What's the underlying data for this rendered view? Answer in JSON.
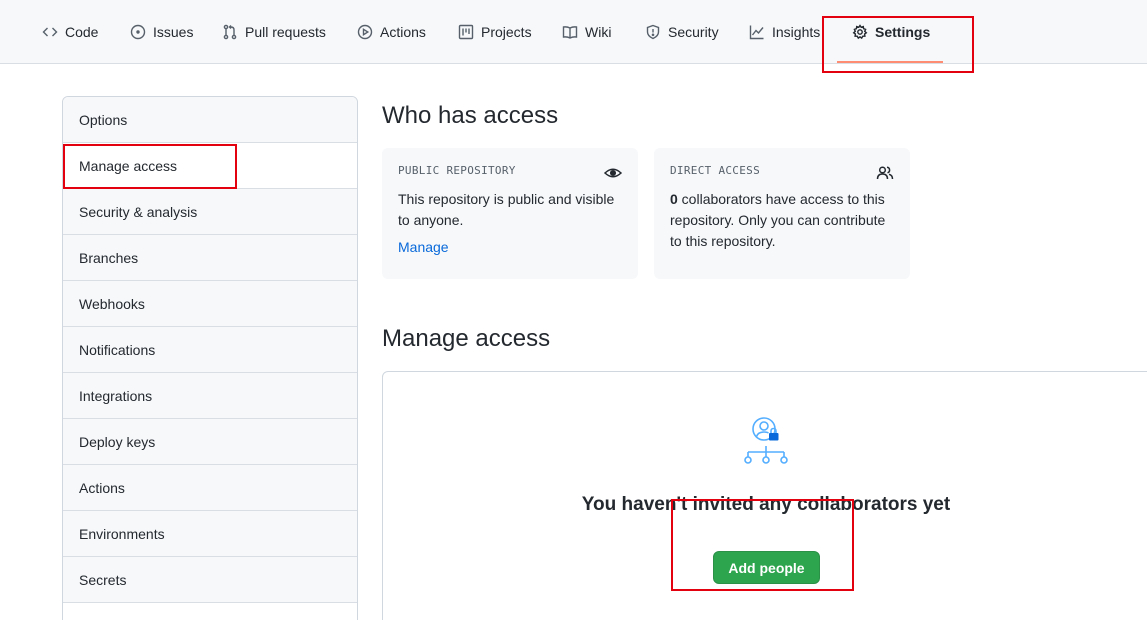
{
  "nav": {
    "tabs": [
      {
        "label": "Code",
        "icon": "code-icon"
      },
      {
        "label": "Issues",
        "icon": "issue-opened-icon"
      },
      {
        "label": "Pull requests",
        "icon": "git-pull-request-icon"
      },
      {
        "label": "Actions",
        "icon": "play-icon"
      },
      {
        "label": "Projects",
        "icon": "project-icon"
      },
      {
        "label": "Wiki",
        "icon": "book-icon"
      },
      {
        "label": "Security",
        "icon": "shield-icon"
      },
      {
        "label": "Insights",
        "icon": "graph-icon"
      },
      {
        "label": "Settings",
        "icon": "gear-icon"
      }
    ],
    "active": "Settings",
    "active_underline_color": "#fd8c73"
  },
  "sidebar": {
    "items": [
      {
        "label": "Options"
      },
      {
        "label": "Manage access"
      },
      {
        "label": "Security & analysis"
      },
      {
        "label": "Branches"
      },
      {
        "label": "Webhooks"
      },
      {
        "label": "Notifications"
      },
      {
        "label": "Integrations"
      },
      {
        "label": "Deploy keys"
      },
      {
        "label": "Actions"
      },
      {
        "label": "Environments"
      },
      {
        "label": "Secrets"
      }
    ],
    "selected": "Manage access"
  },
  "who_has_access": {
    "title": "Who has access",
    "public_card": {
      "label": "PUBLIC REPOSITORY",
      "icon": "eye-icon",
      "text": "This repository is public and visible to anyone.",
      "link": "Manage"
    },
    "direct_card": {
      "label": "DIRECT ACCESS",
      "icon": "people-icon",
      "count": "0",
      "text": " collaborators have access to this repository. Only you can contribute to this repository."
    }
  },
  "manage_access": {
    "title": "Manage access",
    "empty_icon": "people-lock-illustration-icon",
    "empty_message": "You haven't invited any collaborators yet",
    "add_button": "Add people"
  },
  "colors": {
    "accent_link": "#0969da",
    "button_green": "#2da44e",
    "annotation_red": "#e3000f"
  }
}
